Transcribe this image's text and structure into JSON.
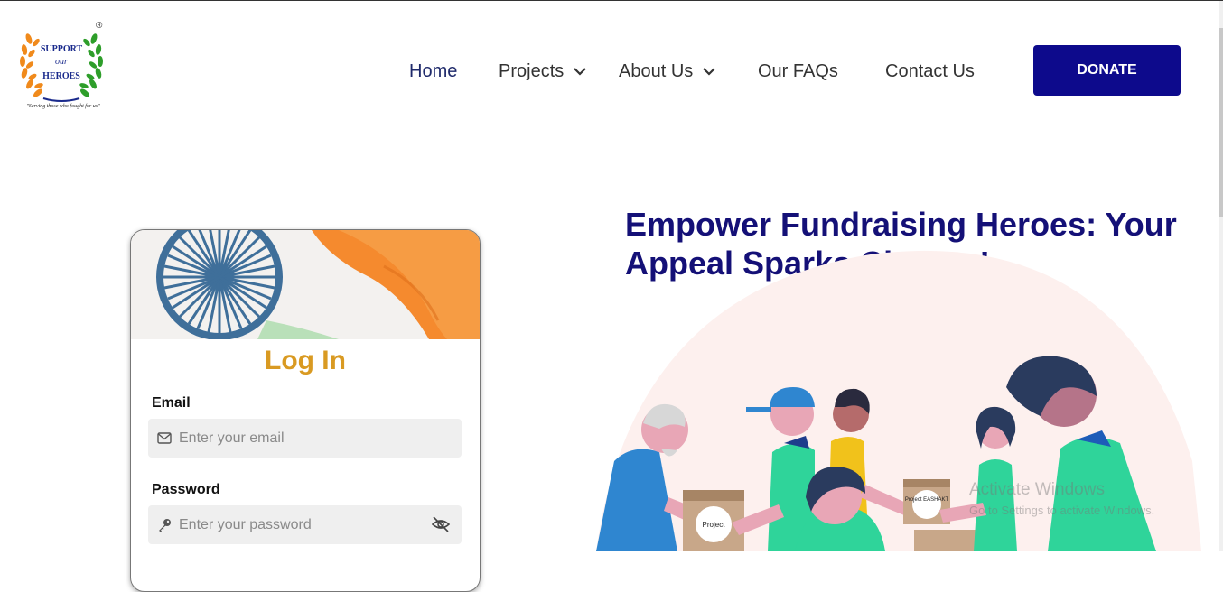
{
  "logo": {
    "line1": "SUPPORT",
    "line2": "our",
    "line3": "HEROES",
    "tagline": "\"Serving those who fought for us\"",
    "registered": "®"
  },
  "nav": {
    "items": [
      {
        "label": "Home",
        "active": true
      },
      {
        "label": "Projects",
        "has_dropdown": true
      },
      {
        "label": "About Us",
        "has_dropdown": true
      },
      {
        "label": "Our FAQs"
      },
      {
        "label": "Contact Us"
      }
    ],
    "donate_label": "DONATE"
  },
  "login": {
    "title": "Log In",
    "email_label": "Email",
    "email_placeholder": "Enter your email",
    "password_label": "Password",
    "password_placeholder": "Enter your password"
  },
  "hero": {
    "title": "Empower Fundraising Heroes: Your Appeal Sparks Change!",
    "box_label_1": "Project",
    "box_label_2": "Project EASHAKT"
  },
  "watermark": {
    "line1": "Activate Windows",
    "line2": "Go to Settings to activate Windows."
  },
  "colors": {
    "brand_navy": "#0d0a8c",
    "title_navy": "#141077",
    "login_gold": "#d99a22",
    "nav_text": "#333333"
  }
}
